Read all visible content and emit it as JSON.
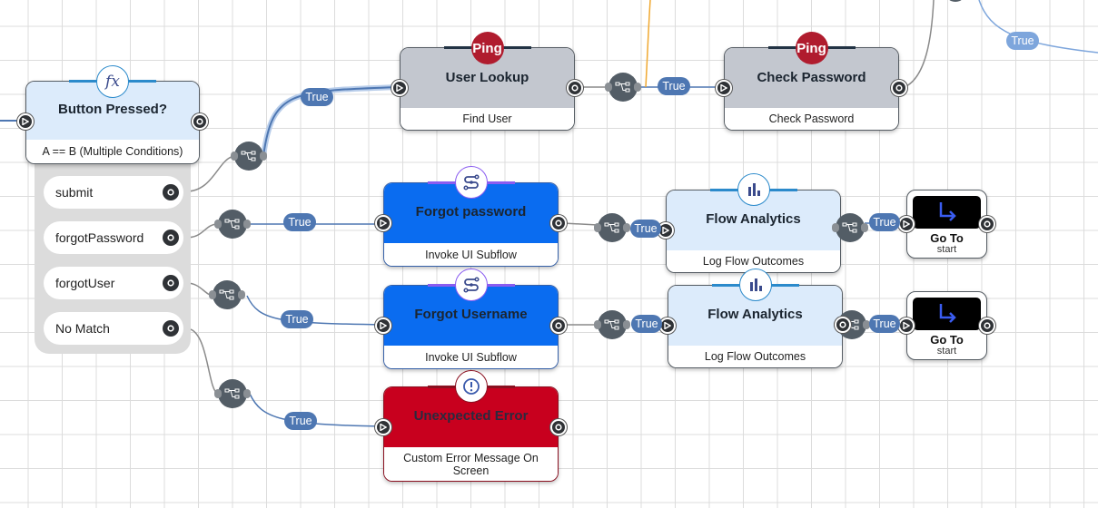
{
  "canvas": {
    "type": "flow-designer",
    "grid": true
  },
  "colors": {
    "connector_node": "#535d66",
    "true_pill": "#4e77b2",
    "true_pill_light": "#7ea6dc",
    "subflow_head": "#0a6cf0",
    "error_head": "#c8001e",
    "function_head": "#dcebfb",
    "ping_head": "#c3c7cf",
    "ping_badge": "#b01c2e",
    "wire_gray": "#8a8a8a",
    "wire_orange": "#f0a830"
  },
  "nodes": {
    "button_pressed": {
      "title": "Button Pressed?",
      "subtitle": "A == B (Multiple Conditions)",
      "icon": "function-fx-icon",
      "icon_text": "fx",
      "outcomes": [
        "submit",
        "forgotPassword",
        "forgotUser",
        "No Match"
      ]
    },
    "user_lookup": {
      "title": "User Lookup",
      "subtitle": "Find User",
      "badge": "Ping"
    },
    "check_password": {
      "title": "Check Password",
      "subtitle": "Check Password",
      "badge": "Ping"
    },
    "forgot_password": {
      "title": "Forgot password",
      "subtitle": "Invoke UI Subflow",
      "icon": "subflow-icon"
    },
    "forgot_username": {
      "title": "Forgot Username",
      "subtitle": "Invoke UI Subflow",
      "icon": "subflow-icon"
    },
    "unexpected_error": {
      "title": "Unexpected Error",
      "subtitle": "Custom Error Message On Screen",
      "icon": "alert-icon"
    },
    "flow_analytics_1": {
      "title": "Flow Analytics",
      "subtitle": "Log Flow Outcomes",
      "icon": "bar-chart-icon"
    },
    "flow_analytics_2": {
      "title": "Flow Analytics",
      "subtitle": "Log Flow Outcomes",
      "icon": "bar-chart-icon"
    },
    "goto_1": {
      "title": "Go To",
      "subtitle": "start",
      "icon": "goto-arrow-icon"
    },
    "goto_2": {
      "title": "Go To",
      "subtitle": "start",
      "icon": "goto-arrow-icon"
    }
  },
  "edges": {
    "label_true": "True",
    "labels": [
      "True",
      "True",
      "True",
      "True",
      "True",
      "True",
      "True",
      "True",
      "True"
    ]
  }
}
